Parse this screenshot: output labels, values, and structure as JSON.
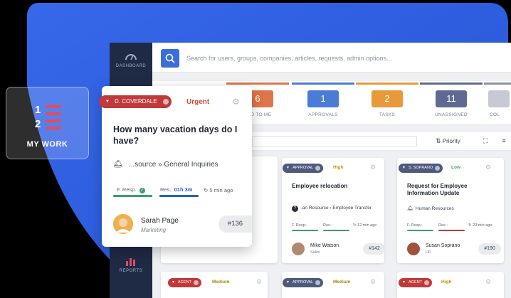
{
  "colors": {
    "accent": "#3a6fd8",
    "red": "#c0393b",
    "urgent": "#d24b3c",
    "high": "#b59a0a",
    "medium": "#a48a12",
    "low": "#3aa06a",
    "slate": "#4d5a7c"
  },
  "mywork": {
    "label": "MY WORK"
  },
  "sidebar": {
    "items": [
      {
        "label": "DASHBOARD",
        "icon": "gauge-icon"
      },
      {
        "label": "REPORTS",
        "icon": "bar-chart-icon"
      }
    ]
  },
  "search": {
    "placeholder": "Search for users, groups, companies, articles, requests, admin options..."
  },
  "tabs": [
    {
      "count": "6",
      "label": "NED TO ME",
      "color": "#e0744a"
    },
    {
      "count": "1",
      "label": "APPROVALS",
      "color": "#4a7bd6"
    },
    {
      "count": "2",
      "label": "TASKS",
      "color": "#e89a3a"
    },
    {
      "count": "11",
      "label": "UNASSIGNED",
      "color": "#5e6a92"
    },
    {
      "count": "",
      "label": "COL",
      "color": "#8a93a3"
    }
  ],
  "toolbar": {
    "priority": "Priority"
  },
  "popup": {
    "assignee": "D. COVERDALE",
    "priority": "Urgent",
    "title": "How many vacation days do I have?",
    "path": "...source » General Inquiries",
    "f_resp": "F. Resp.:",
    "res": "Res.:",
    "res_time": "01h 3m",
    "ago": "5 min ago",
    "person": "Sarah Page",
    "dept": "Marketing",
    "ticket": "#136"
  },
  "cards": [
    {
      "tag": "APPROVAL",
      "priority": "High",
      "title": "Employee relocation",
      "path": ".an Resource › Employee Transfer",
      "f_resp": "F. Resp.:",
      "res": "Res.:",
      "ago": "12 min ago",
      "person": "Mike Watson",
      "dept": "Sales",
      "ticket": "#142"
    },
    {
      "tag": "S. SOPRANO",
      "priority": "Low",
      "title": "Request for Employee Information Update",
      "path": "Human Resources",
      "f_resp": "F. Resp.:",
      "res": "Res.:",
      "ago": "23 min ago",
      "person": "Susan Soprano",
      "dept": "HR",
      "ticket": "#190"
    }
  ],
  "bottom_cards": [
    {
      "tag": "AGENT",
      "priority": "Medium"
    },
    {
      "tag": "APPROVAL",
      "priority": "Medium"
    },
    {
      "tag": "AGENT",
      "priority": "High"
    }
  ]
}
